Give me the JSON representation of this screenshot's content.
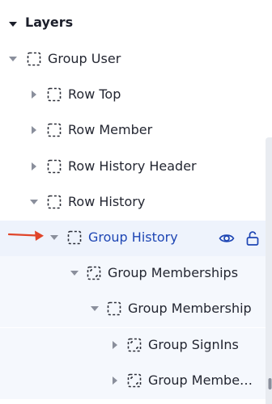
{
  "panel": {
    "title": "Layers",
    "title_toggle_icon": "caret-down-icon"
  },
  "tree": {
    "rows": [
      {
        "label": "Group User",
        "frame_icon": "dashed-frame-icon",
        "toggle": "caret-down-icon",
        "expanded": true
      },
      {
        "label": "Row Top",
        "frame_icon": "dashed-frame-icon",
        "toggle": "caret-right-icon",
        "expanded": false
      },
      {
        "label": "Row Member",
        "frame_icon": "dashed-frame-icon",
        "toggle": "caret-right-icon",
        "expanded": false
      },
      {
        "label": "Row History Header",
        "frame_icon": "dashed-frame-icon",
        "toggle": "caret-right-icon",
        "expanded": false
      },
      {
        "label": "Row History",
        "frame_icon": "dashed-frame-icon",
        "toggle": "caret-down-icon",
        "expanded": true
      },
      {
        "label": "Group History",
        "frame_icon": "dashed-frame-icon",
        "toggle": "caret-down-icon",
        "expanded": true,
        "selected": true
      },
      {
        "label": "Group Memberships",
        "frame_icon": "dashed-frame-corners-icon",
        "toggle": "caret-down-icon",
        "expanded": true
      },
      {
        "label": "Group Membership",
        "frame_icon": "dashed-frame-icon",
        "toggle": "caret-down-icon",
        "expanded": true
      },
      {
        "label": "Group SignIns",
        "frame_icon": "dashed-frame-corners-icon",
        "toggle": "caret-right-icon",
        "expanded": false
      },
      {
        "label": "Group Membe…",
        "frame_icon": "dashed-frame-corners-icon",
        "toggle": "caret-right-icon",
        "expanded": false
      }
    ]
  },
  "selected_actions": {
    "visibility_icon": "eye-icon",
    "lock_icon": "unlock-icon"
  },
  "annotation": {
    "pointer_icon": "red-arrow-icon"
  },
  "colors": {
    "selected_text": "#1e46b4",
    "selected_bg": "#eef3fc",
    "child_bg": "#f5f8fd",
    "arrow": "#e0452a",
    "text": "#232631"
  }
}
